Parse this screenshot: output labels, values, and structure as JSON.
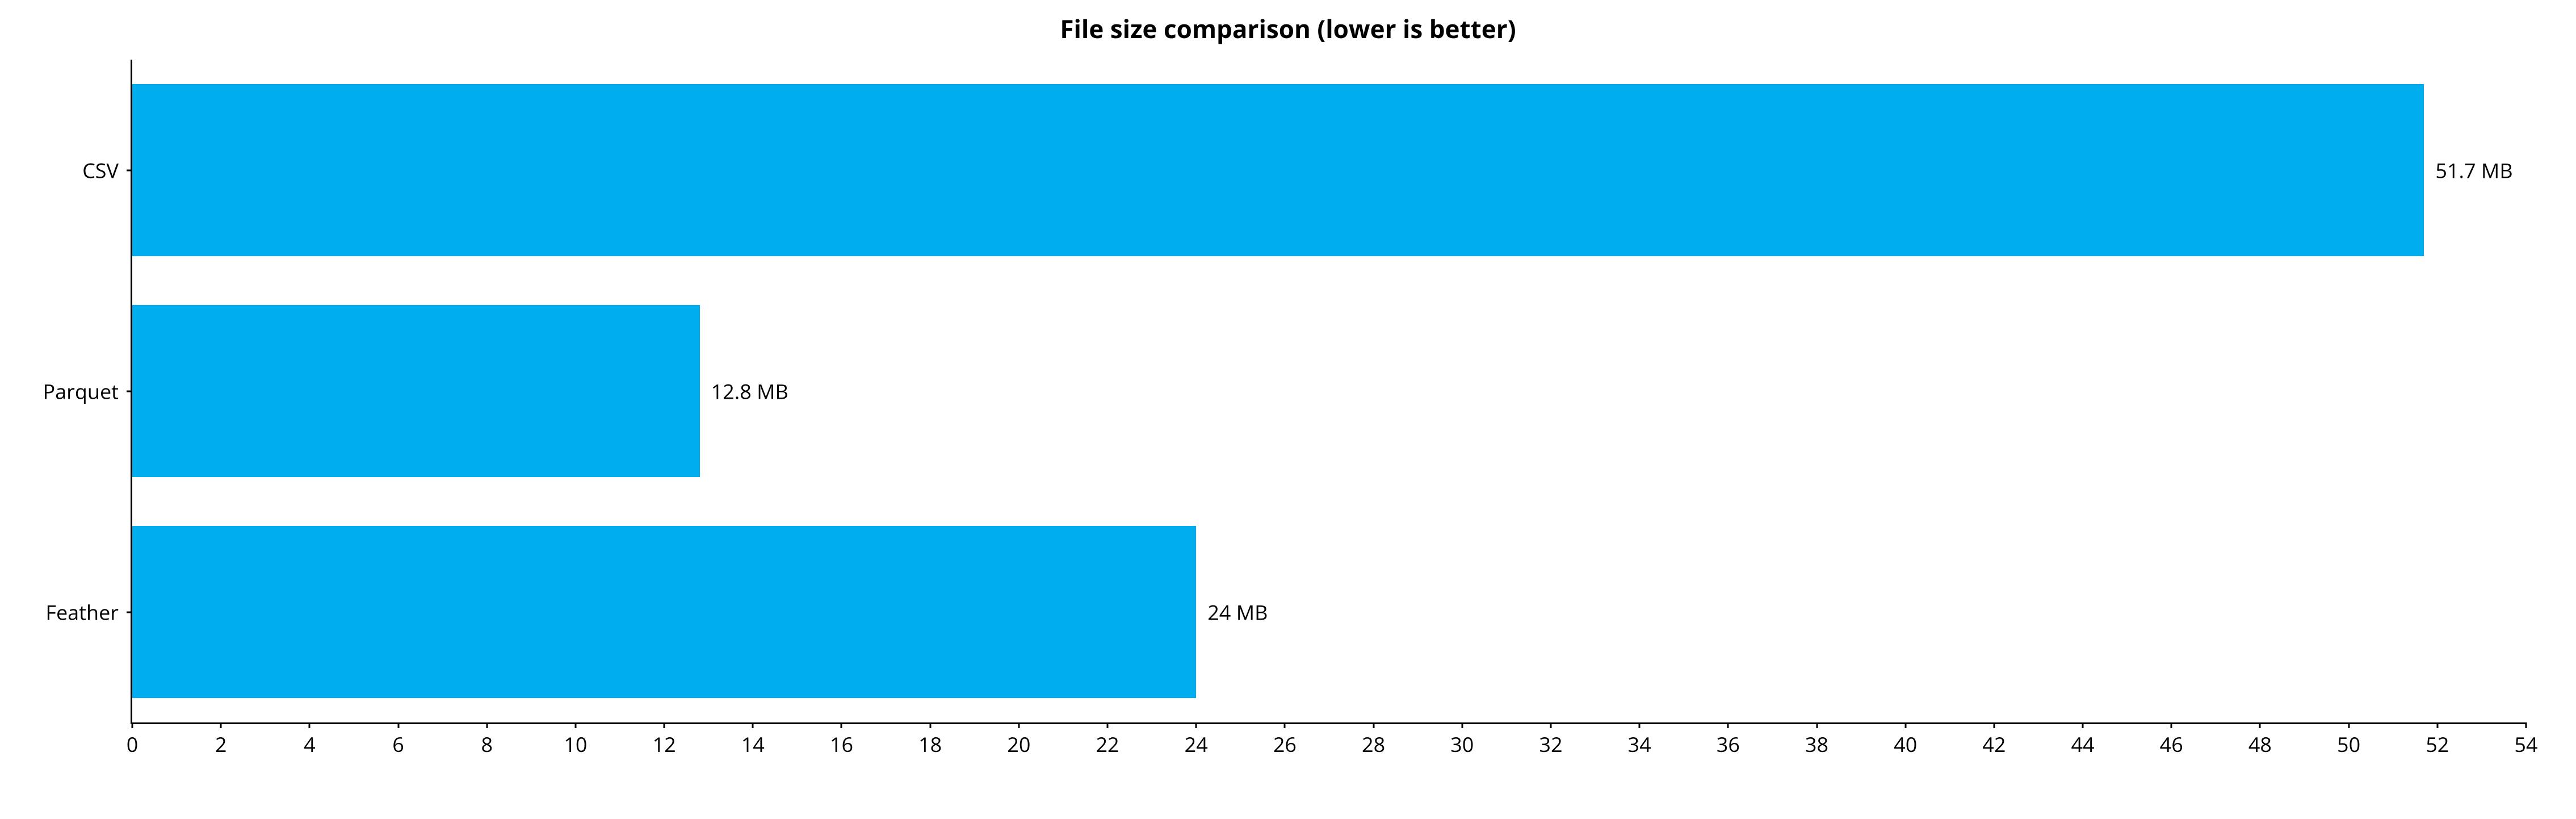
{
  "chart_data": {
    "type": "bar",
    "orientation": "horizontal",
    "title": "File size comparison (lower is better)",
    "categories": [
      "CSV",
      "Parquet",
      "Feather"
    ],
    "values": [
      51.7,
      12.8,
      24
    ],
    "value_labels": [
      "51.7 MB",
      "12.8 MB",
      "24 MB"
    ],
    "xlabel": "",
    "ylabel": "",
    "xlim": [
      0,
      54
    ],
    "x_ticks": [
      0,
      2,
      4,
      6,
      8,
      10,
      12,
      14,
      16,
      18,
      20,
      22,
      24,
      26,
      28,
      30,
      32,
      34,
      36,
      38,
      40,
      42,
      44,
      46,
      48,
      50,
      52,
      54
    ],
    "bar_color": "#00aeef"
  }
}
